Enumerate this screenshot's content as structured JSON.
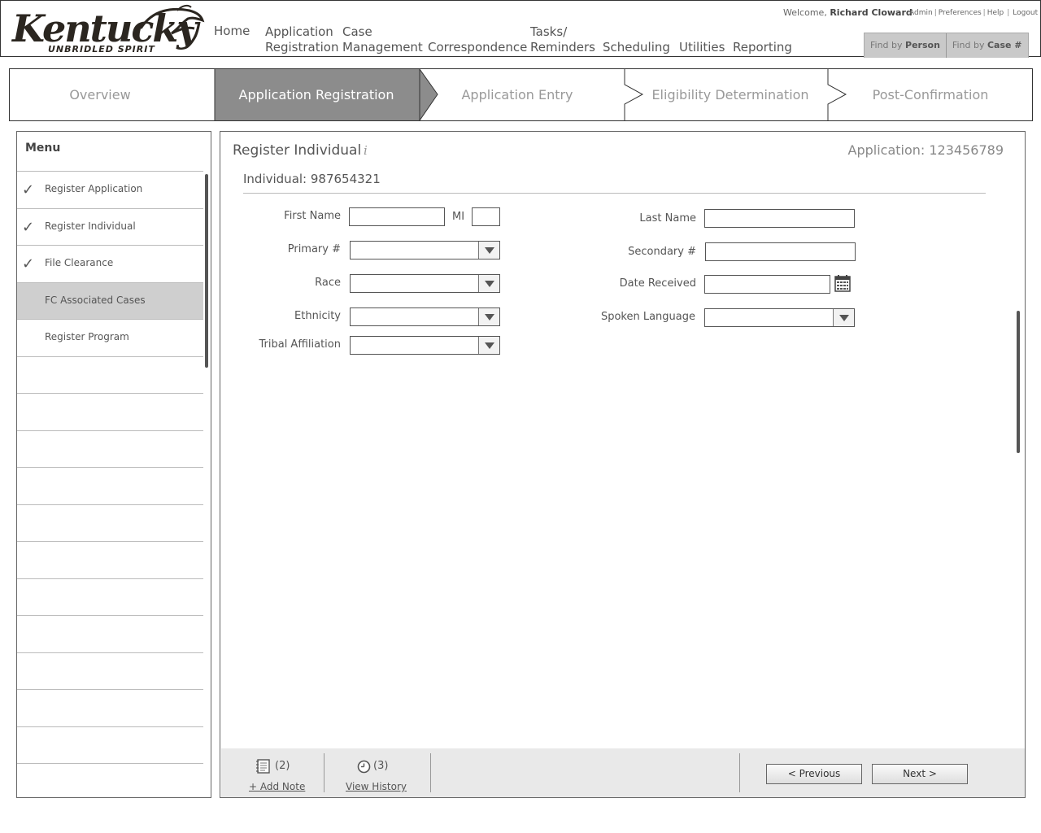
{
  "header": {
    "logo_text": "Kentucky",
    "logo_tagline": "UNBRIDLED SPIRIT",
    "nav": [
      {
        "line1": "",
        "line2": "Home"
      },
      {
        "line1": "Application",
        "line2": "Registration"
      },
      {
        "line1": "Case",
        "line2": "Management"
      },
      {
        "line1": "",
        "line2": "Correspondence"
      },
      {
        "line1": "Tasks/",
        "line2": "Reminders"
      },
      {
        "line1": "",
        "line2": "Scheduling"
      },
      {
        "line1": "",
        "line2": "Utilities"
      },
      {
        "line1": "",
        "line2": "Reporting"
      }
    ],
    "welcome_prefix": "Welcome,",
    "user_name": "Richard Cloward",
    "links": {
      "admin": "Admin",
      "preferences": "Preferences",
      "help": "Help",
      "logout": "Logout"
    },
    "find_person": {
      "prefix": "Find by",
      "bold": "Person"
    },
    "find_case": {
      "prefix": "Find by",
      "bold": "Case #"
    }
  },
  "steps": {
    "items": [
      "Overview",
      "Application Registration",
      "Application Entry",
      "Eligibility Determination",
      "Post-Confirmation"
    ],
    "active_index": 1
  },
  "menu": {
    "title": "Menu",
    "items": [
      {
        "label": "Register Application",
        "checked": true
      },
      {
        "label": "Register Individual",
        "checked": true
      },
      {
        "label": "File Clearance",
        "checked": true
      },
      {
        "label": "FC Associated Cases",
        "checked": false,
        "selected": true
      },
      {
        "label": "Register Program",
        "checked": false
      }
    ],
    "check_glyph": "✓"
  },
  "main": {
    "title": "Register Individual",
    "info_icon": "i",
    "application_number": "Application: 123456789",
    "individual": "Individual: 987654321",
    "form": {
      "first_name_label": "First Name",
      "first_name_value": "",
      "mi_label": "MI",
      "mi_value": "",
      "last_name_label": "Last Name",
      "last_name_value": "",
      "primary_label": "Primary #",
      "primary_value": "",
      "secondary_label": "Secondary #",
      "secondary_value": "",
      "race_label": "Race",
      "race_value": "",
      "date_received_label": "Date Received",
      "date_received_value": "",
      "ethnicity_label": "Ethnicity",
      "ethnicity_value": "",
      "spoken_language_label": "Spoken Language",
      "spoken_language_value": "",
      "tribal_label": "Tribal Affiliation",
      "tribal_value": ""
    },
    "footer": {
      "notes_count": "(2)",
      "add_note": "+ Add Note",
      "history_count": "(3)",
      "view_history": "View History",
      "previous": "< Previous",
      "next": "Next >"
    }
  },
  "colors": {
    "active_step": "#8c8c8c",
    "selected_menu": "#cfcfcf",
    "footer_bg": "#e9e9e9"
  }
}
